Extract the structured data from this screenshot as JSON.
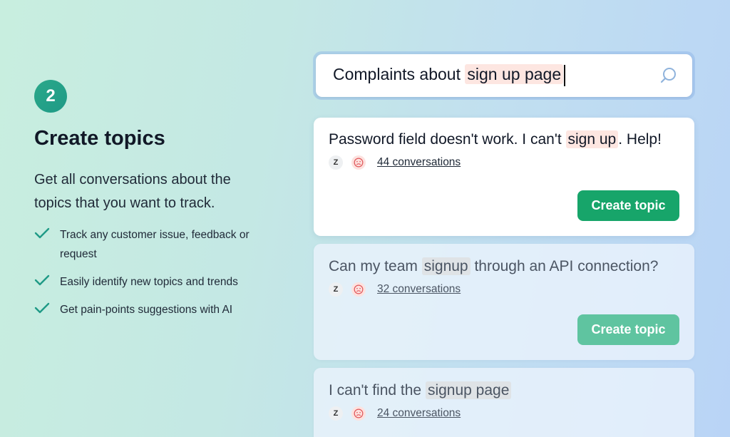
{
  "left": {
    "step_number": "2",
    "title": "Create topics",
    "description": "Get all conversations about the topics that you want to track.",
    "features": [
      "Track any customer issue, feedback or request",
      "Easily identify new topics and trends",
      "Get pain-points suggestions with AI"
    ]
  },
  "search": {
    "prefix": "Complaints about ",
    "highlight": "sign up page",
    "icon": "search-icon"
  },
  "cards": [
    {
      "title_before": "Password field doesn't work. I can't ",
      "title_highlight": "sign up",
      "title_after": ". Help!",
      "conversations": "44 conversations",
      "button": "Create topic"
    },
    {
      "title_before": "Can my team ",
      "title_highlight": "signup",
      "title_after": " through an API connection?",
      "conversations": "32 conversations",
      "button": "Create topic"
    },
    {
      "title_before": "I can't find the ",
      "title_highlight": "signup page",
      "title_after": "",
      "conversations": "24 conversations"
    }
  ],
  "colors": {
    "accent_green": "#17a56a",
    "highlight": "#fde6e1",
    "step_badge": "#2aa88a"
  },
  "icons": {
    "source": "zendesk-icon",
    "sentiment": "sad-face-icon",
    "check": "check-icon"
  }
}
